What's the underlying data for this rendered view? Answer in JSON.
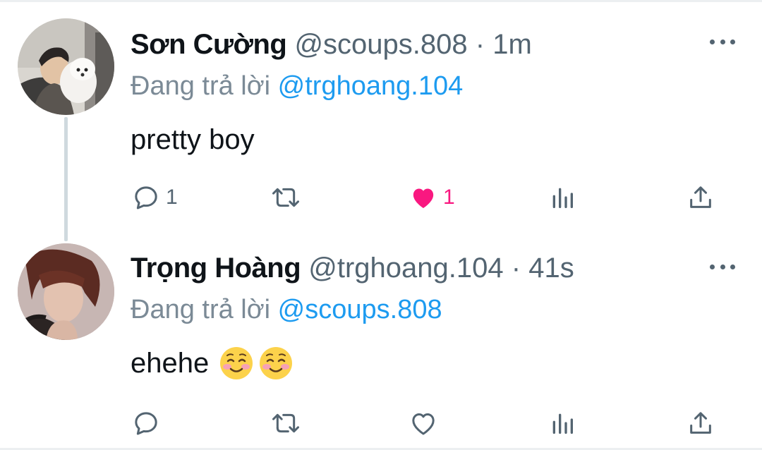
{
  "colors": {
    "text": "#0f1419",
    "secondary": "#536471",
    "link": "#1d9bf0",
    "like": "#f91880",
    "thread_line": "#cfd9de"
  },
  "tweets": [
    {
      "display_name": "Sơn Cường",
      "handle": "@scoups.808",
      "separator": "·",
      "time": "1m",
      "replying_prefix": "Đang trả lời",
      "replying_to": "@trghoang.104",
      "text": "pretty boy",
      "emojis": [],
      "reply_count": "1",
      "retweet_count": "",
      "like_count": "1",
      "liked": true,
      "icons": {
        "reply": "reply-icon",
        "retweet": "retweet-icon",
        "like": "heart-filled-icon",
        "analytics": "analytics-icon",
        "share": "share-icon",
        "more": "more-icon"
      }
    },
    {
      "display_name": "Trọng Hoàng",
      "handle": "@trghoang.104",
      "separator": "·",
      "time": "41s",
      "replying_prefix": "Đang trả lời",
      "replying_to": "@scoups.808",
      "text": "ehehe",
      "emojis": [
        "smiling-face-icon",
        "smiling-face-icon"
      ],
      "reply_count": "",
      "retweet_count": "",
      "like_count": "",
      "liked": false,
      "icons": {
        "reply": "reply-icon",
        "retweet": "retweet-icon",
        "like": "heart-outline-icon",
        "analytics": "analytics-icon",
        "share": "share-icon",
        "more": "more-icon"
      }
    }
  ]
}
